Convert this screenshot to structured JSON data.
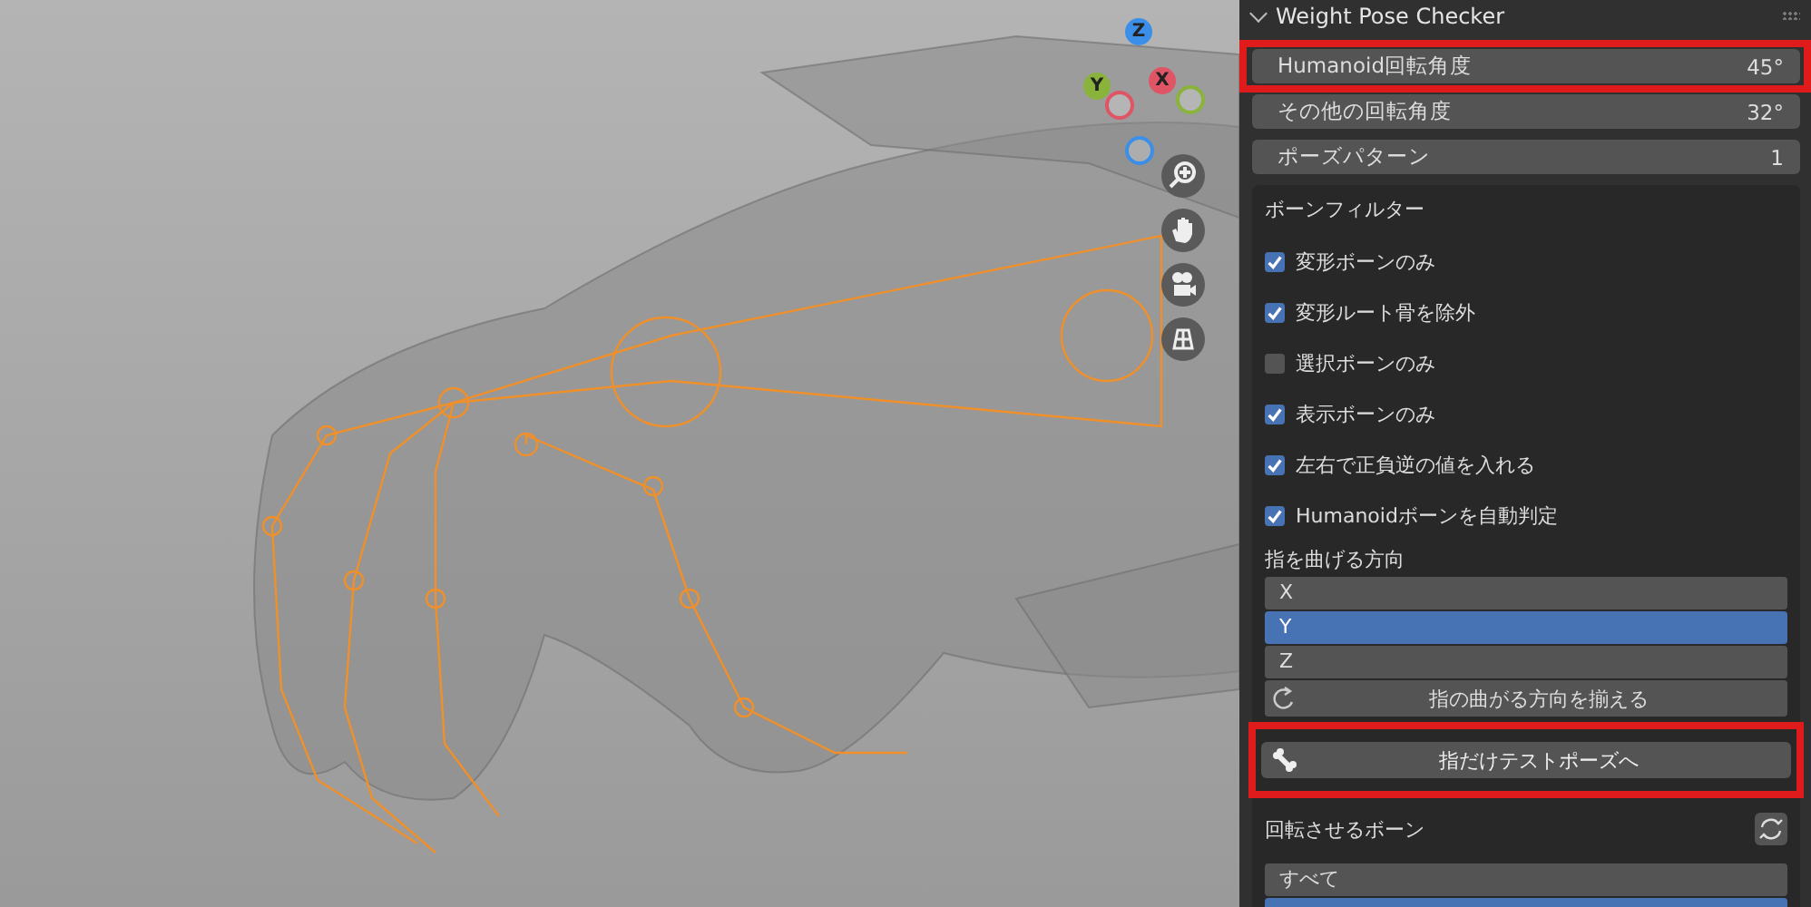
{
  "panel": {
    "title": "Weight Pose Checker",
    "expanded": true
  },
  "fields": [
    {
      "label": "Humanoid回転角度",
      "value": "45°",
      "highlighted": true
    },
    {
      "label": "その他の回転角度",
      "value": "32°",
      "highlighted": false
    },
    {
      "label": "ポーズパターン",
      "value": "1",
      "highlighted": false
    }
  ],
  "bone_filter": {
    "title": "ボーンフィルター",
    "options": [
      {
        "label": "変形ボーンのみ",
        "checked": true
      },
      {
        "label": "変形ルート骨を除外",
        "checked": true
      },
      {
        "label": "選択ボーンのみ",
        "checked": false
      },
      {
        "label": "表示ボーンのみ",
        "checked": true
      },
      {
        "label": "左右で正負逆の値を入れる",
        "checked": true
      },
      {
        "label": "Humanoidボーンを自動判定",
        "checked": true
      }
    ],
    "direction_label": "指を曲げる方向",
    "directions": [
      {
        "label": "X",
        "selected": false
      },
      {
        "label": "Y",
        "selected": true
      },
      {
        "label": "Z",
        "selected": false
      }
    ],
    "align_button": "指の曲がる方向を揃える",
    "test_pose_button": {
      "label": "指だけテストポーズへ",
      "highlighted": true
    },
    "rotate_label": "回転させるボーン",
    "rotate_items": [
      {
        "label": "すべて",
        "selected": false
      },
      {
        "selected": true
      }
    ]
  },
  "gizmo": {
    "axes": [
      "Z",
      "Y",
      "X"
    ]
  }
}
